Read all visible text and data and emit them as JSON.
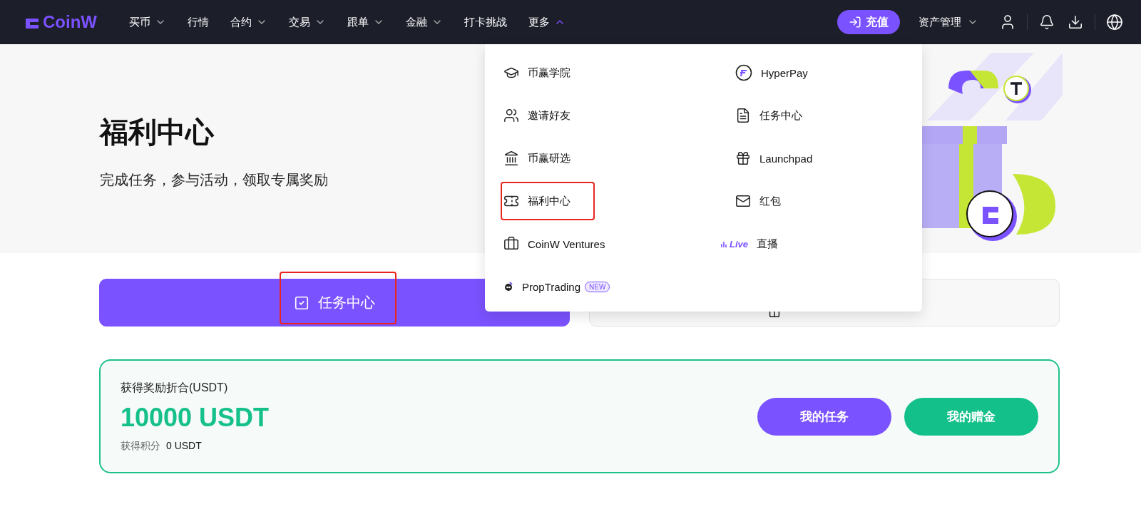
{
  "nav": {
    "logo": "CoinW",
    "items": [
      {
        "label": "买币",
        "expanded": false
      },
      {
        "label": "行情"
      },
      {
        "label": "合约",
        "expanded": false
      },
      {
        "label": "交易",
        "expanded": false
      },
      {
        "label": "跟单",
        "expanded": false
      },
      {
        "label": "金融",
        "expanded": false
      },
      {
        "label": "打卡挑战"
      },
      {
        "label": "更多",
        "expanded": true
      }
    ],
    "deposit": "充值",
    "assets": "资产管理"
  },
  "hero": {
    "title": "福利中心",
    "subtitle": "完成任务，参与活动，领取专属奖励"
  },
  "dropdown": {
    "columns": [
      [
        {
          "label": "币赢学院",
          "annotated": false
        },
        {
          "label": "邀请好友",
          "annotated": false
        },
        {
          "label": "币赢研选",
          "annotated": false
        },
        {
          "label": "福利中心",
          "annotated": true
        },
        {
          "label": "CoinW Ventures",
          "annotated": false
        },
        {
          "label": "PropTrading",
          "badge": "NEW",
          "annotated": false
        }
      ],
      [
        {
          "label": "HyperPay",
          "annotated": false
        },
        {
          "label": "任务中心",
          "annotated": false
        },
        {
          "label": "Launchpad",
          "annotated": false
        },
        {
          "label": "红包",
          "annotated": false
        },
        {
          "label": "直播",
          "icon_text": "Live",
          "annotated": false
        }
      ]
    ]
  },
  "tabs": [
    {
      "label": "任务中心",
      "selected": true,
      "annotated": true
    },
    {
      "selected": false,
      "annotated": false
    }
  ],
  "summary": {
    "label": "获得奖励折合(USDT)",
    "amount": "10000 USDT",
    "points_label": "获得积分",
    "points_value": "0 USDT",
    "buttons": [
      {
        "label": "我的任务",
        "kind": "primary"
      },
      {
        "label": "我的赠金",
        "kind": "success"
      }
    ]
  }
}
